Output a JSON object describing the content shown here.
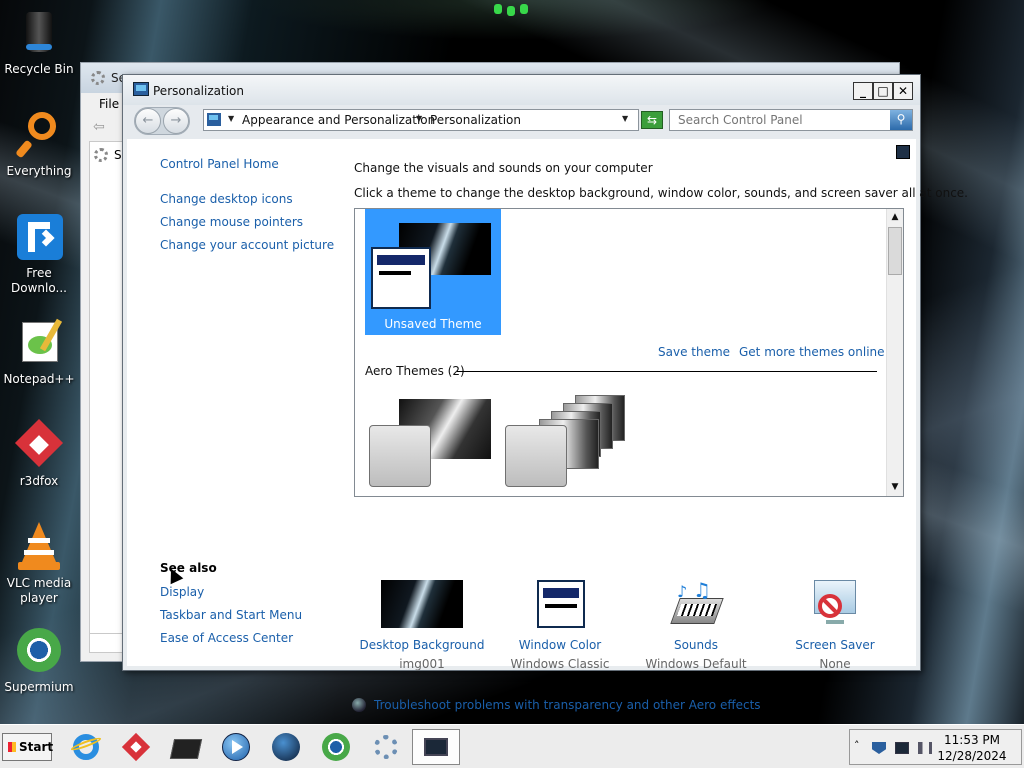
{
  "desktop": {
    "icons": [
      {
        "label": "Recycle Bin"
      },
      {
        "label": "Everything"
      },
      {
        "label": "Free\nDownlo..."
      },
      {
        "label": "Notepad++"
      },
      {
        "label": "r3dfox"
      },
      {
        "label": "VLC media\nplayer"
      },
      {
        "label": "Supermium"
      }
    ]
  },
  "bg_window": {
    "title": "Se",
    "menu_file": "File",
    "tree_item": "Se"
  },
  "window": {
    "title": "Personalization",
    "controls": {
      "minimize": "_",
      "maximize": "□",
      "close": "✕"
    }
  },
  "address": {
    "crumbs": [
      "Appearance and Personalization",
      "Personalization"
    ],
    "search_placeholder": "Search Control Panel"
  },
  "left_nav": {
    "home": "Control Panel Home",
    "links": [
      "Change desktop icons",
      "Change mouse pointers",
      "Change your account picture"
    ],
    "see_also_title": "See also",
    "see_also": [
      "Display",
      "Taskbar and Start Menu",
      "Ease of Access Center"
    ]
  },
  "main": {
    "heading": "Change the visuals and sounds on your computer",
    "subheading": "Click a theme to change the desktop background, window color, sounds, and screen saver all at once.",
    "selected_theme": "Unsaved Theme",
    "save_theme": "Save theme",
    "get_more": "Get more themes online",
    "group_title": "Aero Themes (2)",
    "options": [
      {
        "name": "Desktop Background",
        "value": "img001"
      },
      {
        "name": "Window Color",
        "value": "Windows Classic"
      },
      {
        "name": "Sounds",
        "value": "Windows Default"
      },
      {
        "name": "Screen Saver",
        "value": "None"
      }
    ],
    "troubleshoot": "Troubleshoot problems with transparency and other Aero effects"
  },
  "taskbar": {
    "start": "Start",
    "time": "11:53 PM",
    "date": "12/28/2024"
  },
  "colors": {
    "link": "#1a5faa",
    "selection": "#3399ff",
    "taskbar": "#ececec"
  },
  "icon_names": [
    "recycle-bin-icon",
    "everything-icon",
    "free-download-icon",
    "notepad-plus-icon",
    "r3dfox-icon",
    "vlc-icon",
    "supermium-icon",
    "ie-icon",
    "media-player-icon",
    "gear-icon",
    "shield-icon",
    "network-icon",
    "volume-icon"
  ]
}
